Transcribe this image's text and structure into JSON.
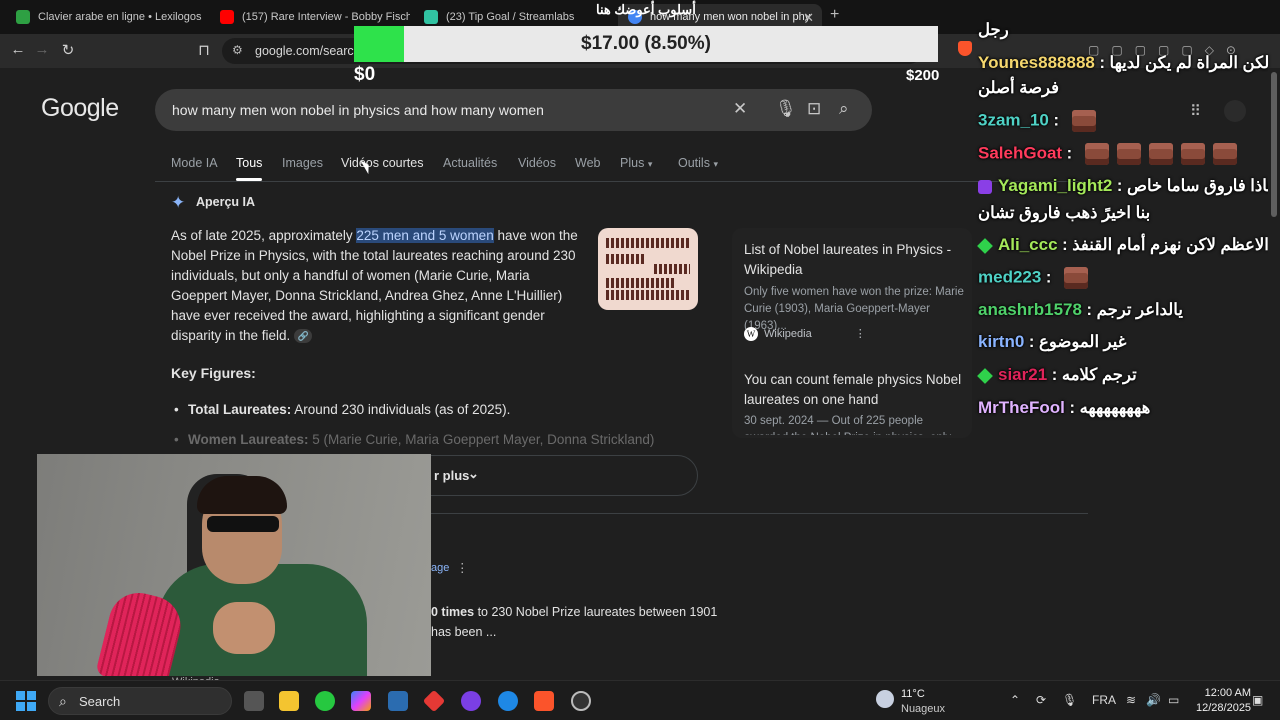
{
  "browser": {
    "tabs": [
      {
        "title": "Clavier arabe en ligne • Lexilogos",
        "fav_color": "#2ea043"
      },
      {
        "title": "(157) Rare Interview - Bobby Fischer",
        "fav_color": "#ff0000"
      },
      {
        "title": "(23) Tip Goal / Streamlabs",
        "fav_color": "#31c3a2"
      },
      {
        "title": "how many men won nobel in phy",
        "fav_color": "#4285f4"
      }
    ],
    "overlay_title": "أسلوب أعوضك هنا",
    "url": "google.com/search"
  },
  "tip_goal": {
    "amount_text": "$17.00 (8.50%)",
    "min": "$0",
    "max": "$200",
    "progress": 0.085,
    "fill_color": "#2ee24b"
  },
  "google": {
    "logo": "Google",
    "query": "how many men won nobel in physics and how many women",
    "tabs": [
      "Mode IA",
      "Tous",
      "Images",
      "Vidéos courtes",
      "Actualités",
      "Vidéos",
      "Web",
      "Plus",
      "Outils"
    ],
    "active_tab": "Tous",
    "ai_overview": {
      "heading": "Aperçu IA",
      "para_before": "As of late 2025, approximately ",
      "highlight": "225 men and 5 women",
      "para_after": " have won the Nobel Prize in Physics, with the total laureates reaching around 230 individuals, but only a handful of women (Marie Curie, Maria Goeppert Mayer, Donna Strickland, Andrea Ghez, Anne L'Huillier) have ever received the award, highlighting a significant gender disparity in the field.",
      "key_figures": "Key Figures:",
      "bullet1_label": "Total Laureates:",
      "bullet1_text": " Around 230 individuals (as of 2025).",
      "bullet2_label": "Women Laureates:",
      "bullet2_text": " 5 (Marie Curie, Maria Goeppert Mayer, Donna Strickland)",
      "show_more": "r plus"
    },
    "side_results": [
      {
        "title": "List of Nobel laureates in Physics - Wikipedia",
        "snippet": "Only five women have won the prize: Marie Curie (1903), Maria Goeppert-Mayer (1963)...",
        "source": "Wikipedia"
      },
      {
        "title": "You can count female physics Nobel laureates on one hand",
        "snippet": "30 sept. 2024 — Out of 225 people awarded the Nobel Prize in physics, only five have been..."
      }
    ],
    "result_fragments": {
      "page": "age",
      "times_bold": "0 times",
      "times_rest": " to 230 Nobel Prize laureates between 1901",
      "line2": "has been ...",
      "wiki": "Wikipedia"
    }
  },
  "chat": [
    {
      "user": "",
      "text": "رجل",
      "color": "#ffffff"
    },
    {
      "user": "Younes888888",
      "text": "لكن المراة لم يكن لديها",
      "color": "#f5d76e"
    },
    {
      "user": "",
      "text": "فرصة أصلن",
      "color": "#ffffff"
    },
    {
      "user": "3zam_10",
      "text": "",
      "color": "#4fd1c5",
      "emotes": 1
    },
    {
      "user": "SalehGoat",
      "text": "",
      "color": "#ff3b5c",
      "emotes": 5
    },
    {
      "user": "Yagami_light2",
      "text": "هاذا فاروق ساما خاص",
      "color": "#a4e85a",
      "badge": "cube"
    },
    {
      "user": "",
      "text": "بنا اخيرً ذهب فاروق تشان",
      "color": "#ffffff"
    },
    {
      "user": "Ali_ccc",
      "text": "الرجال الاعظم لاكن نهزم أمام القنفذ",
      "color": "#a4e85a",
      "badge": "diamond"
    },
    {
      "user": "med223",
      "text": "",
      "color": "#4fd1c5",
      "emotes": 1
    },
    {
      "user": "anashrb1578",
      "text": "يالداعر ترجم",
      "color": "#4fd16a"
    },
    {
      "user": "kirtn0",
      "text": "غير الموضوع",
      "color": "#8ab4ff"
    },
    {
      "user": "siar21",
      "text": "ترجم كلامه",
      "color": "#e0245a",
      "badge": "diamond"
    },
    {
      "user": "MrTheFool",
      "text": "ههههههههه",
      "color": "#e0b3ff"
    }
  ],
  "taskbar": {
    "search_label": "Search",
    "weather_temp": "11°C",
    "weather_desc": "Nuageux",
    "lang": "FRA",
    "time": "12:00 AM",
    "date": "12/28/2025"
  }
}
